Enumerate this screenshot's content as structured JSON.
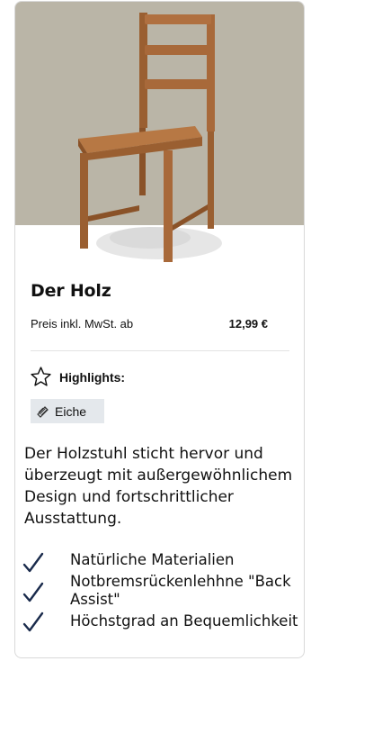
{
  "product": {
    "image_icon": "wooden-chair-image",
    "title": "Der Holz",
    "price_label": "Preis inkl. MwSt. ab",
    "price_value": "12,99 €"
  },
  "highlights": {
    "icon": "star-outline-icon",
    "label": "Highlights:",
    "tag": {
      "icon": "wood-grain-icon",
      "label": "Eiche"
    }
  },
  "description": "Der Holzstuhl sticht hervor und überzeugt mit außergewöhnlichem Design und fortschrittlicher Ausstattung.",
  "features": [
    {
      "icon": "checkmark-icon",
      "label": "Natürliche Materialien"
    },
    {
      "icon": "checkmark-icon",
      "label": "Notbremsrückenlehhne \"Back Assist\""
    },
    {
      "icon": "checkmark-icon",
      "label": "Höchstgrad an Bequemlichkeit"
    }
  ],
  "colors": {
    "image_background": "#bab5a7",
    "wood": "#a8693a",
    "wood_dark": "#8a5228",
    "checkmark": "#1a2b4c",
    "tag_background": "#e4e8ec"
  }
}
